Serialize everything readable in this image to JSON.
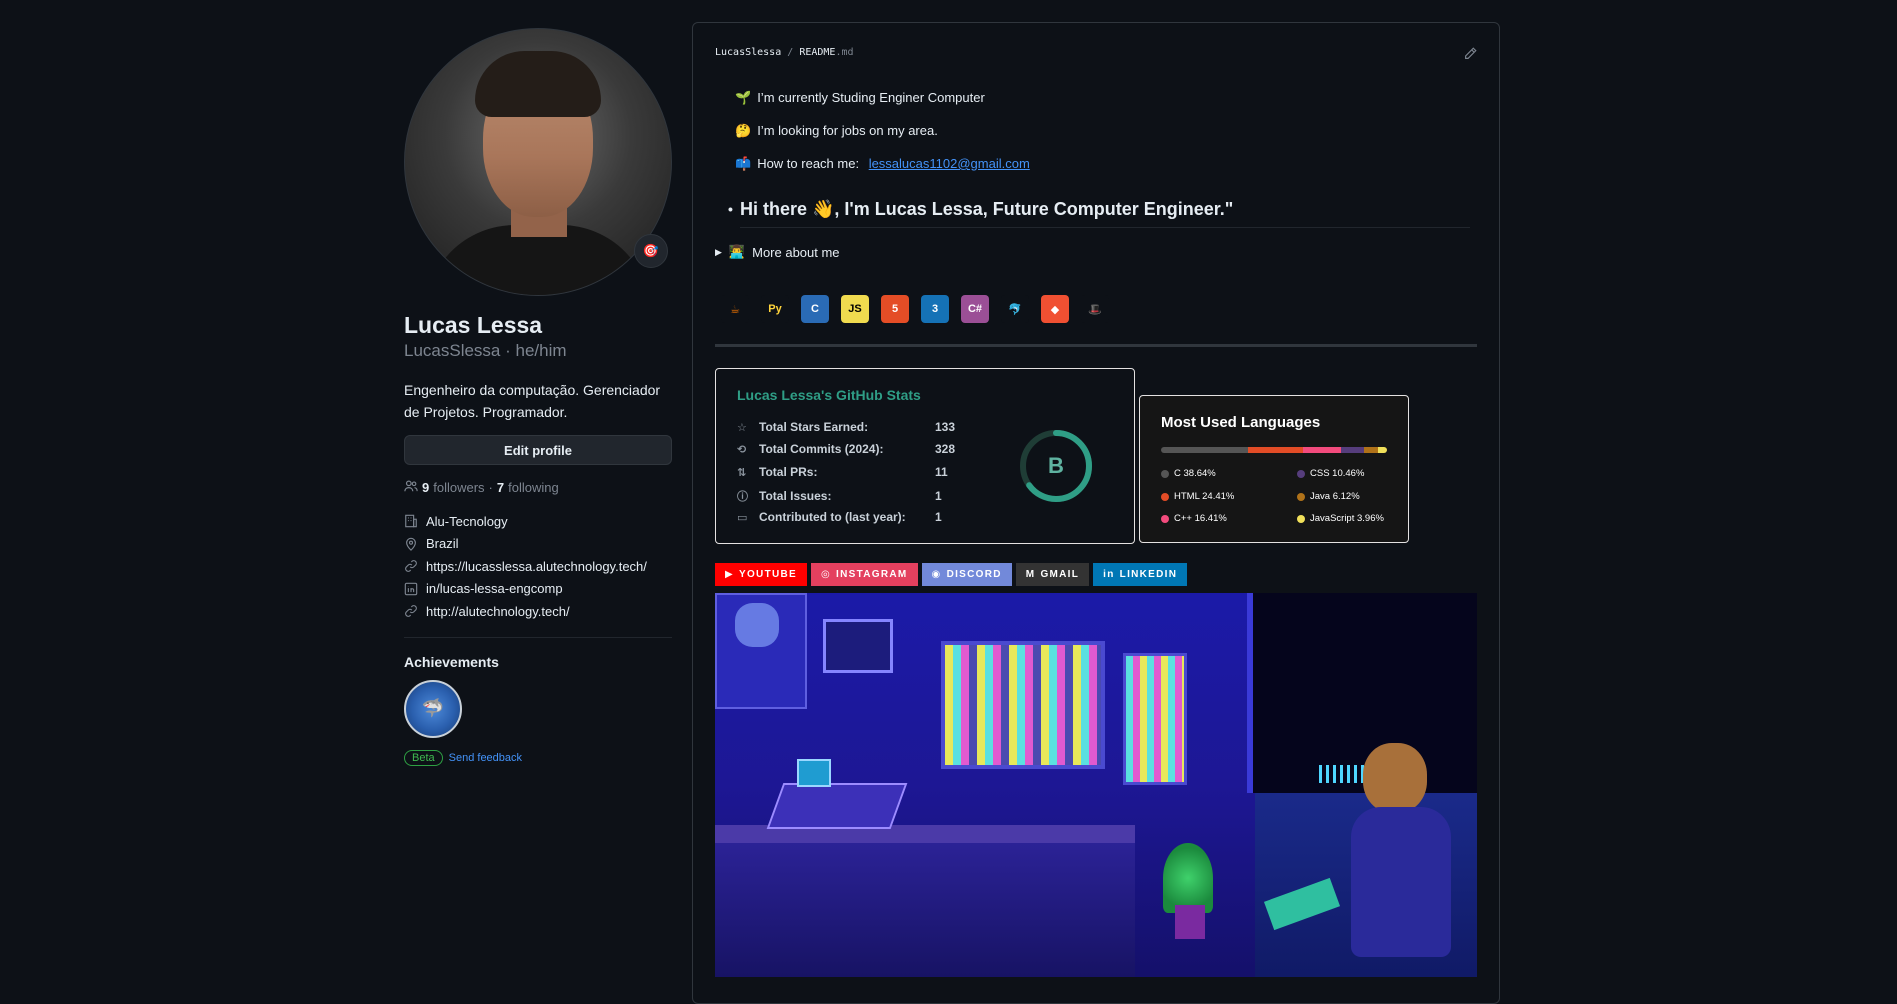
{
  "profile": {
    "name": "Lucas Lessa",
    "login_pronouns": "LucasSlessa · he/him",
    "bio": "Engenheiro da computação. Gerenciador de Projetos. Programador.",
    "edit_label": "Edit profile",
    "followers_count": "9",
    "followers_label": "followers",
    "dot": "·",
    "following_count": "7",
    "following_label": "following",
    "status_emoji": "🎯",
    "details": [
      {
        "icon": "organization-icon",
        "text": "Alu-Tecnology"
      },
      {
        "icon": "location-icon",
        "text": "Brazil"
      },
      {
        "icon": "link-icon",
        "text": "https://lucasslessa.alutechnology.tech/"
      },
      {
        "icon": "linkedin-icon",
        "text": "in/lucas-lessa-engcomp"
      },
      {
        "icon": "link-icon",
        "text": "http://alutechnology.tech/"
      }
    ],
    "achievements_title": "Achievements",
    "beta_label": "Beta",
    "feedback_label": "Send feedback"
  },
  "readme": {
    "owner": "LucasSlessa",
    "slash": "/",
    "file": "README",
    "ext": ".md",
    "bullets": [
      {
        "emoji": "🌱",
        "text": "I’m currently Studing Enginer Computer"
      },
      {
        "emoji": "🤔",
        "text": "I’m looking for jobs on my area."
      },
      {
        "emoji": "📫",
        "text": "How to reach me: ",
        "link": "lessalucas1102@gmail.com"
      }
    ],
    "heading": "Hi there 👋, I'm Lucas Lessa, Future Computer Engineer.\"",
    "more_arrow": "▶",
    "more_emoji": "👨‍💻",
    "more_label": "More about me",
    "tech_icons": [
      {
        "name": "java-icon",
        "label": "☕",
        "bg": "#0d1117",
        "fg": "#e76f00"
      },
      {
        "name": "python-icon",
        "label": "Py",
        "bg": "#0d1117",
        "fg": "#ffd43b"
      },
      {
        "name": "c-icon",
        "label": "C",
        "bg": "#2a6bb5",
        "fg": "#ffffff"
      },
      {
        "name": "javascript-icon",
        "label": "JS",
        "bg": "#f0db4f",
        "fg": "#000000"
      },
      {
        "name": "html5-icon",
        "label": "5",
        "bg": "#e44d26",
        "fg": "#ffffff"
      },
      {
        "name": "css3-icon",
        "label": "3",
        "bg": "#1572b6",
        "fg": "#ffffff"
      },
      {
        "name": "csharp-icon",
        "label": "C#",
        "bg": "#9b4f96",
        "fg": "#ffffff"
      },
      {
        "name": "mysql-icon",
        "label": "🐬",
        "bg": "#0d1117",
        "fg": "#4479a1"
      },
      {
        "name": "git-icon",
        "label": "◆",
        "bg": "#f05032",
        "fg": "#ffffff"
      },
      {
        "name": "redhat-icon",
        "label": "🎩",
        "bg": "#0d1117",
        "fg": "#ee0000"
      }
    ]
  },
  "stats": {
    "title": "Lucas Lessa's GitHub Stats",
    "rows": [
      {
        "icon": "star-icon",
        "glyph": "☆",
        "label": "Total Stars Earned:",
        "value": "133"
      },
      {
        "icon": "history-icon",
        "glyph": "⟲",
        "label": "Total Commits (2024):",
        "value": "328"
      },
      {
        "icon": "pull-request-icon",
        "glyph": "⇅",
        "label": "Total PRs:",
        "value": "11"
      },
      {
        "icon": "issue-icon",
        "glyph": "ⓘ",
        "label": "Total Issues:",
        "value": "1"
      },
      {
        "icon": "repo-icon",
        "glyph": "▭",
        "label": "Contributed to (last year):",
        "value": "1"
      }
    ],
    "rank": "B",
    "rank_progress": 0.35
  },
  "languages": {
    "title": "Most Used Languages",
    "items": [
      {
        "name": "C",
        "pct": 38.64,
        "label": "C 38.64%",
        "color": "#555555"
      },
      {
        "name": "HTML",
        "pct": 24.41,
        "label": "HTML 24.41%",
        "color": "#e34c26"
      },
      {
        "name": "C++",
        "pct": 16.41,
        "label": "C++ 16.41%",
        "color": "#f34b7d"
      },
      {
        "name": "CSS",
        "pct": 10.46,
        "label": "CSS 10.46%",
        "color": "#563d7c"
      },
      {
        "name": "Java",
        "pct": 6.12,
        "label": "Java 6.12%",
        "color": "#b07219"
      },
      {
        "name": "JavaScript",
        "pct": 3.96,
        "label": "JavaScript 3.96%",
        "color": "#f1e05a"
      }
    ]
  },
  "socials": [
    {
      "name": "youtube-button",
      "icon": "youtube-icon",
      "glyph": "▶",
      "label": "YOUTUBE",
      "bg": "#ff0000"
    },
    {
      "name": "instagram-button",
      "icon": "instagram-icon",
      "glyph": "◎",
      "label": "INSTAGRAM",
      "bg": "#e4405f"
    },
    {
      "name": "discord-button",
      "icon": "discord-icon",
      "glyph": "◉",
      "label": "DISCORD",
      "bg": "#7289da"
    },
    {
      "name": "gmail-button",
      "icon": "gmail-icon",
      "glyph": "M",
      "label": "GMAIL",
      "bg": "#333333"
    },
    {
      "name": "linkedin-button",
      "icon": "linkedin-icon",
      "glyph": "in",
      "label": "LINKEDIN",
      "bg": "#0077b5"
    }
  ],
  "colors": {
    "background": "#0d1117",
    "link": "#4493f8",
    "stats_title": "#2f9e86"
  }
}
